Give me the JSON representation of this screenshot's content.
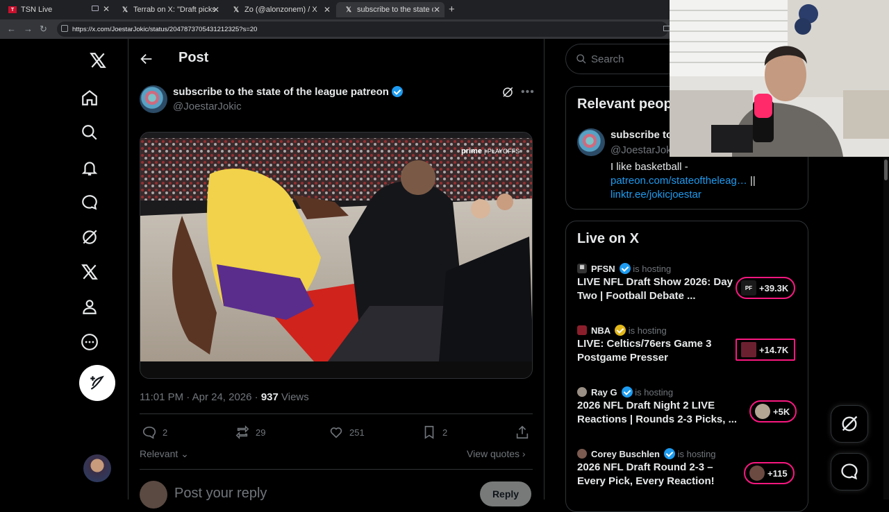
{
  "browser": {
    "tabs": [
      {
        "title": "TSN Live",
        "active": false
      },
      {
        "title": "Terrab on X: \"Draft picks so bad",
        "active": false
      },
      {
        "title": "Zo (@alonzonem) / X",
        "active": false
      },
      {
        "title": "subscribe to the state of the le",
        "active": true
      }
    ],
    "url": "https://x.com/JoestarJokic/status/2047873705431212325?s=20"
  },
  "post": {
    "header": "Post",
    "author": {
      "name": "subscribe to the state of the league patreon",
      "handle": "@JoestarJokic"
    },
    "timestamp": "11:01 PM · Apr 24, 2026 · ",
    "views_count": "937",
    "views_label": " Views",
    "actions": {
      "replies": "2",
      "reposts": "29",
      "likes": "251",
      "bookmarks": "2"
    },
    "sort_label": "Relevant",
    "view_quotes": "View quotes",
    "reply_placeholder": "Post your reply",
    "reply_button": "Reply"
  },
  "search": {
    "placeholder": "Search"
  },
  "relevant_people": {
    "title": "Relevant people",
    "name": "subscribe to the state of the league patreon",
    "handle": "@JoestarJok",
    "bio_prefix": "I like basketball -",
    "link1": "patreon.com/stateoftheleag…",
    "separator": " ||",
    "link2": "linktr.ee/jokicjoestar"
  },
  "live_on_x": {
    "title": "Live on X",
    "hosting_label": "is hosting",
    "items": [
      {
        "host": "PFSN",
        "verified": "blue",
        "title": "LIVE NFL Draft Show 2026: Day Two | Football Debate ...",
        "count": "+39.3K"
      },
      {
        "host": "NBA",
        "verified": "gold",
        "title": "LIVE: Celtics/76ers Game 3 Postgame Presser",
        "count": "+14.7K"
      },
      {
        "host": "Ray G",
        "verified": "blue",
        "title": "2026 NFL Draft Night 2 LIVE Reactions | Rounds 2-3 Picks, ...",
        "count": "+5K"
      },
      {
        "host": "Corey Buschlen",
        "verified": "blue",
        "title": "2026 NFL Draft Round 2-3 – Every Pick, Every Reaction!",
        "count": "+115"
      }
    ]
  },
  "colors": {
    "accent": "#1d9bf0",
    "live": "#f91880",
    "bg": "#000000"
  }
}
